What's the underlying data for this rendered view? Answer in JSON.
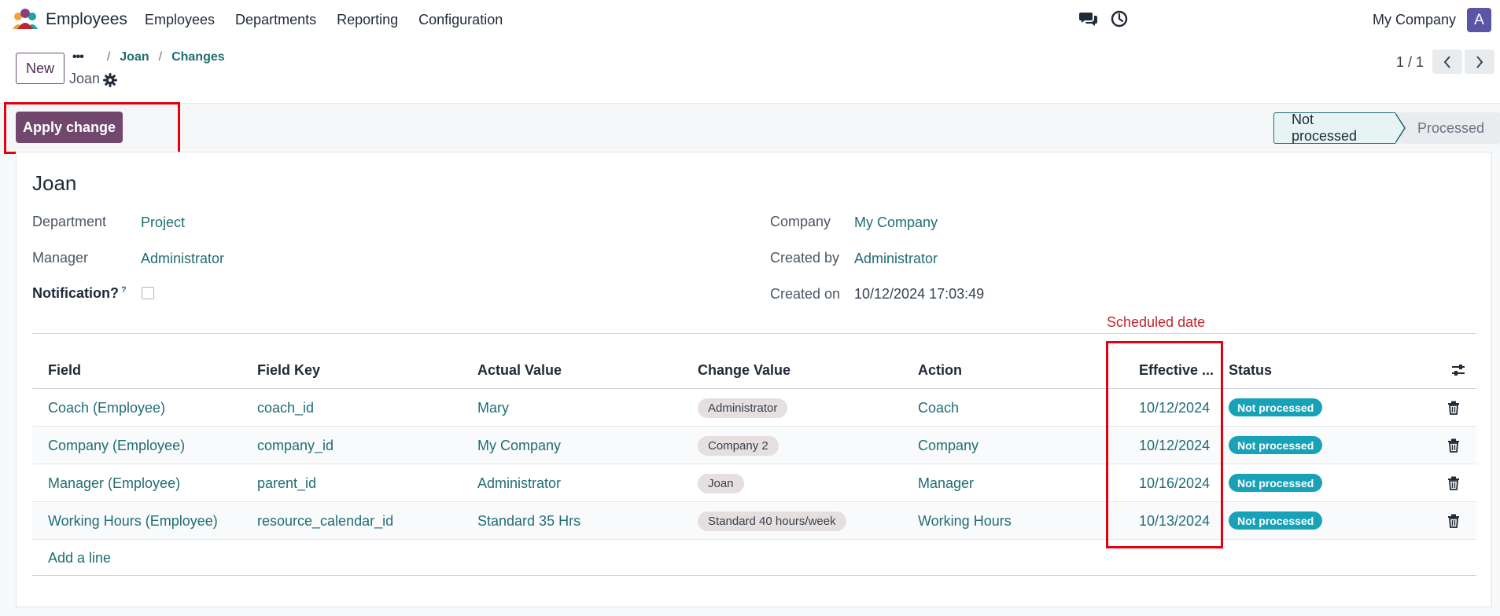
{
  "navbar": {
    "app_name": "Employees",
    "menu": [
      "Employees",
      "Departments",
      "Reporting",
      "Configuration"
    ],
    "company": "My Company",
    "avatar_letter": "A"
  },
  "control_panel": {
    "new_label": "New",
    "breadcrumb": {
      "dots": "•••",
      "items": [
        "Joan",
        "Changes"
      ]
    },
    "record_title": "Joan",
    "pager": "1 / 1"
  },
  "action_bar": {
    "apply_label": "Apply change",
    "statuses": [
      "Not processed",
      "Processed"
    ],
    "active_status": "Not processed"
  },
  "form": {
    "employee_name": "Joan",
    "fields_left": [
      {
        "label": "Department",
        "value": "Project"
      },
      {
        "label": "Manager",
        "value": "Administrator"
      }
    ],
    "notification_label": "Notification?",
    "notification_help": "?",
    "notification_checked": false,
    "fields_right": [
      {
        "label": "Company",
        "value": "My Company"
      },
      {
        "label": "Created by",
        "value": "Administrator"
      },
      {
        "label": "Created on",
        "value": "10/12/2024 17:03:49"
      }
    ]
  },
  "annotation": {
    "scheduled_date": "Scheduled date"
  },
  "table": {
    "headers": [
      "Field",
      "Field Key",
      "Actual Value",
      "Change Value",
      "Action",
      "Effective ...",
      "Status"
    ],
    "rows": [
      {
        "field": "Coach (Employee)",
        "key": "coach_id",
        "actual": "Mary",
        "change": "Administrator",
        "action": "Coach",
        "date": "10/12/2024",
        "status": "Not processed"
      },
      {
        "field": "Company (Employee)",
        "key": "company_id",
        "actual": "My Company",
        "change": "Company 2",
        "action": "Company",
        "date": "10/12/2024",
        "status": "Not processed"
      },
      {
        "field": "Manager (Employee)",
        "key": "parent_id",
        "actual": "Administrator",
        "change": "Joan",
        "action": "Manager",
        "date": "10/16/2024",
        "status": "Not processed"
      },
      {
        "field": "Working Hours (Employee)",
        "key": "resource_calendar_id",
        "actual": "Standard 35 Hrs",
        "change": "Standard 40 hours/week",
        "action": "Working Hours",
        "date": "10/13/2024",
        "status": "Not processed"
      }
    ],
    "add_line": "Add a line"
  },
  "colors": {
    "primary": "#71476e",
    "link": "#1f6d73",
    "status_badge": "#17a2b8",
    "highlight_box": "#e3000f",
    "annotation_text": "#c0262d"
  }
}
